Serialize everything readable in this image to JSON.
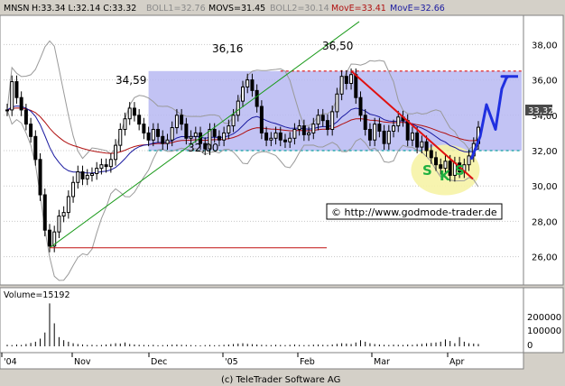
{
  "header": {
    "ticker": "MNSN",
    "ohlc": "H:33.34 L:32.14 C:33.32",
    "boll1": "BOLL1=32.76",
    "movs": "MOVS=31.45",
    "boll2": "BOLL2=30.14",
    "move1": "MovE=33.41",
    "move2": "MovE=32.66"
  },
  "colors": {
    "price": "#000000",
    "boll": "#9a9a9a",
    "movs": "#1a1aa0",
    "move_red": "#b01010",
    "move_blue": "#1a1aa0",
    "range_fill": "#b7b9f2",
    "trend_green": "#1a9a1a",
    "trend_red": "#e01010",
    "forecast_blue": "#2030e0",
    "sks_fill": "#f6f3a6",
    "sks_text": "#20b040",
    "last_price_box": "#4a4a4a"
  },
  "annotations": {
    "peak1": "34,59",
    "peak2": "36,16",
    "peak3": "36,50",
    "support": "32,00",
    "s1": "S",
    "k": "K",
    "s2": "S",
    "watermark": "© http://www.godmode-trader.de",
    "last_price": "33,32"
  },
  "volume": {
    "label": "Volume=15192",
    "ticks": [
      "200000",
      "100000",
      "0"
    ]
  },
  "footer": "(c) TeleTrader Software AG",
  "chart_data": {
    "type": "candlestick",
    "title": "",
    "ylim": [
      24.5,
      39.5
    ],
    "y_ticks": [
      "38,00",
      "36,00",
      "34,00",
      "32,00",
      "30,00",
      "28,00",
      "26,00"
    ],
    "x_ticks": [
      "'04",
      "Nov",
      "Dec",
      "'05",
      "Feb",
      "Mar",
      "Apr"
    ],
    "levels": {
      "support": 32.0,
      "resistance": 36.5,
      "low": 26.5
    },
    "close_series": [
      34.3,
      35.9,
      35.0,
      34.3,
      33.5,
      32.8,
      31.5,
      29.5,
      27.5,
      26.6,
      27.4,
      28.3,
      28.5,
      29.4,
      30.2,
      30.8,
      30.4,
      30.6,
      30.7,
      31.0,
      31.2,
      31.1,
      31.5,
      32.3,
      33.2,
      33.8,
      34.4,
      34.0,
      33.5,
      33.0,
      32.6,
      33.2,
      32.8,
      32.4,
      32.6,
      33.3,
      34.0,
      33.5,
      32.7,
      32.8,
      33.0,
      32.4,
      32.1,
      33.2,
      32.8,
      32.6,
      33.0,
      33.4,
      34.0,
      34.8,
      35.6,
      36.0,
      35.4,
      34.5,
      33.0,
      32.6,
      32.7,
      33.0,
      32.6,
      32.5,
      32.7,
      33.2,
      33.4,
      32.9,
      33.0,
      33.5,
      34.0,
      33.7,
      33.2,
      34.2,
      35.2,
      36.2,
      35.8,
      36.3,
      35.0,
      34.0,
      33.2,
      32.6,
      33.5,
      33.1,
      32.4,
      33.1,
      33.4,
      33.9,
      33.7,
      32.6,
      33.0,
      32.2,
      32.5,
      32.0,
      31.6,
      31.2,
      31.0,
      31.4,
      30.6,
      31.3,
      30.8,
      31.2,
      31.7,
      32.4,
      33.32
    ],
    "volume_series": [
      10000,
      8000,
      12000,
      9000,
      15000,
      22000,
      30000,
      50000,
      90000,
      280000,
      150000,
      60000,
      40000,
      30000,
      20000,
      15000,
      12000,
      9000,
      10000,
      8000,
      9000,
      12000,
      15000,
      20000,
      18000,
      25000,
      15000,
      12000,
      10000,
      9000,
      8000,
      10000,
      7000,
      8000,
      9000,
      11000,
      12000,
      10000,
      9000,
      8000,
      7000,
      6000,
      8000,
      9000,
      7000,
      8000,
      10000,
      12000,
      15000,
      18000,
      20000,
      16000,
      14000,
      12000,
      10000,
      9000,
      8000,
      10000,
      9000,
      8000,
      10000,
      12000,
      9000,
      8000,
      9000,
      11000,
      12000,
      10000,
      9000,
      12000,
      16000,
      20000,
      18000,
      15000,
      25000,
      40000,
      30000,
      20000,
      15000,
      12000,
      10000,
      9000,
      11000,
      10000,
      9000,
      12000,
      10000,
      14000,
      16000,
      20000,
      22000,
      25000,
      30000,
      45000,
      35000,
      20000,
      60000,
      30000,
      20000,
      18000,
      15192
    ]
  }
}
